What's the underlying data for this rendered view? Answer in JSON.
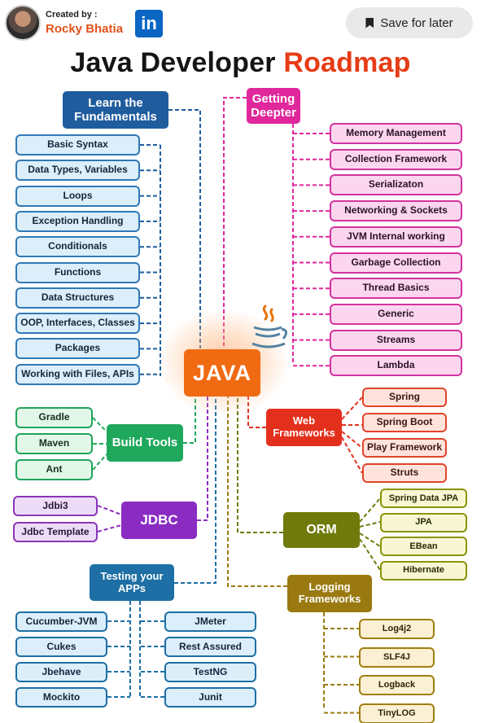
{
  "header": {
    "created_by": "Created by :",
    "author": "Rocky Bhatia",
    "linkedin_icon": "in",
    "save_button": "Save for later"
  },
  "title": {
    "main": "Java Developer ",
    "accent": "Roadmap"
  },
  "center": {
    "label": "JAVA",
    "icon": "java-coffee-cup-icon"
  },
  "fundamentals": {
    "title": "Learn the Fundamentals",
    "color": "#1f5c9e",
    "items": [
      "Basic Syntax",
      "Data Types, Variables",
      "Loops",
      "Exception Handling",
      "Conditionals",
      "Functions",
      "Data Structures",
      "OOP, Interfaces, Classes",
      "Packages",
      "Working with Files, APIs"
    ]
  },
  "deeper": {
    "title": "Getting Deepter",
    "color": "#e0279b",
    "items": [
      "Memory Management",
      "Collection Framework",
      "Serializaton",
      "Networking & Sockets",
      "JVM Internal working",
      "Garbage Collection",
      "Thread Basics",
      "Generic",
      "Streams",
      "Lambda"
    ]
  },
  "build": {
    "title": "Build Tools",
    "color": "#1fa85c",
    "items": [
      "Gradle",
      "Maven",
      "Ant"
    ]
  },
  "web": {
    "title": "Web Frameworks",
    "color": "#e3301c",
    "items": [
      "Spring",
      "Spring Boot",
      "Play Framework",
      "Struts"
    ]
  },
  "jdbc": {
    "title": "JDBC",
    "color": "#8a2cc2",
    "items": [
      "Jdbi3",
      "Jdbc Template"
    ]
  },
  "orm": {
    "title": "ORM",
    "color": "#6f7a0a",
    "items": [
      "Spring Data JPA",
      "JPA",
      "EBean",
      "Hibernate"
    ]
  },
  "testing": {
    "title": "Testing your APPs",
    "color": "#1d6fa5",
    "left": [
      "Cucumber-JVM",
      "Cukes",
      "Jbehave",
      "Mockito"
    ],
    "right": [
      "JMeter",
      "Rest Assured",
      "TestNG",
      "Junit"
    ]
  },
  "logging": {
    "title": "Logging Frameworks",
    "color": "#9a7a10",
    "items": [
      "Log4j2",
      "SLF4J",
      "Logback",
      "TinyLOG"
    ]
  }
}
